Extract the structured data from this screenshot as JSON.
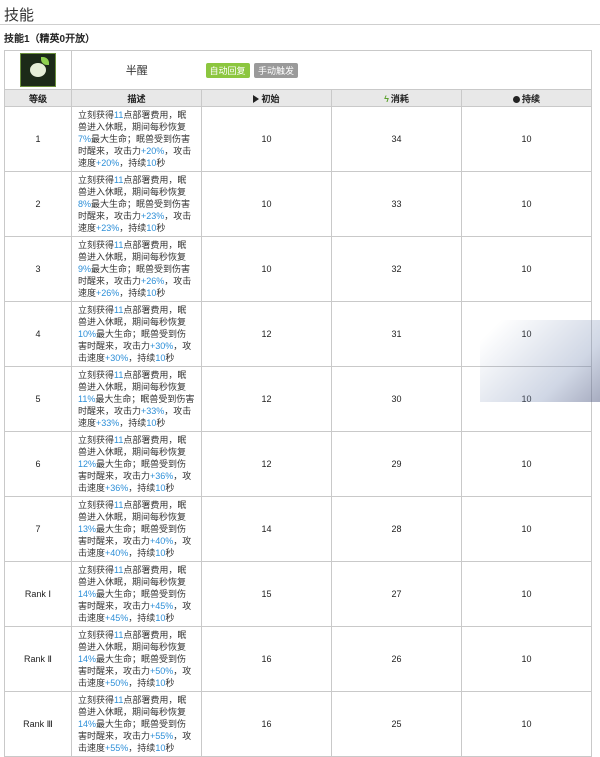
{
  "section_title": "技能",
  "skill_sub": "技能1（精英0开放）",
  "skill": {
    "name": "半醒",
    "icon": "sleeping-creature-icon",
    "tags": [
      "自动回复",
      "手动触发"
    ]
  },
  "columns": {
    "level": "等级",
    "desc": "描述",
    "initial": "初始",
    "cost": "消耗",
    "duration": "持续"
  },
  "rows": [
    {
      "level": "1",
      "p1": "立刻获得",
      "sp": "11",
      "p2": "点部署费用，眠兽进入休眠，期间每秒恢复",
      "heal": "7%",
      "p3": "最大生命；眠兽受到伤害时醒来，攻击力",
      "atk": "+20%",
      "p4": "，攻击速度",
      "aspd": "+20%",
      "p5": "，持续",
      "dur": "10",
      "p6": "秒",
      "initial": "10",
      "cost": "34",
      "duration": "10"
    },
    {
      "level": "2",
      "p1": "立刻获得",
      "sp": "11",
      "p2": "点部署费用，眠兽进入休眠，期间每秒恢复",
      "heal": "8%",
      "p3": "最大生命；眠兽受到伤害时醒来，攻击力",
      "atk": "+23%",
      "p4": "，攻击速度",
      "aspd": "+23%",
      "p5": "，持续",
      "dur": "10",
      "p6": "秒",
      "initial": "10",
      "cost": "33",
      "duration": "10"
    },
    {
      "level": "3",
      "p1": "立刻获得",
      "sp": "11",
      "p2": "点部署费用，眠兽进入休眠，期间每秒恢复",
      "heal": "9%",
      "p3": "最大生命；眠兽受到伤害时醒来，攻击力",
      "atk": "+26%",
      "p4": "，攻击速度",
      "aspd": "+26%",
      "p5": "，持续",
      "dur": "10",
      "p6": "秒",
      "initial": "10",
      "cost": "32",
      "duration": "10"
    },
    {
      "level": "4",
      "p1": "立刻获得",
      "sp": "11",
      "p2": "点部署费用，眠兽进入休眠，期间每秒恢复",
      "heal": "10%",
      "p3": "最大生命；眠兽受到伤害时醒来，攻击力",
      "atk": "+30%",
      "p4": "，攻击速度",
      "aspd": "+30%",
      "p5": "，持续",
      "dur": "10",
      "p6": "秒",
      "initial": "12",
      "cost": "31",
      "duration": "10"
    },
    {
      "level": "5",
      "p1": "立刻获得",
      "sp": "11",
      "p2": "点部署费用，眠兽进入休眠，期间每秒恢复",
      "heal": "11%",
      "p3": "最大生命；眠兽受到伤害时醒来，攻击力",
      "atk": "+33%",
      "p4": "，攻击速度",
      "aspd": "+33%",
      "p5": "，持续",
      "dur": "10",
      "p6": "秒",
      "initial": "12",
      "cost": "30",
      "duration": "10"
    },
    {
      "level": "6",
      "p1": "立刻获得",
      "sp": "11",
      "p2": "点部署费用，眠兽进入休眠，期间每秒恢复",
      "heal": "12%",
      "p3": "最大生命；眠兽受到伤害时醒来，攻击力",
      "atk": "+36%",
      "p4": "，攻击速度",
      "aspd": "+36%",
      "p5": "，持续",
      "dur": "10",
      "p6": "秒",
      "initial": "12",
      "cost": "29",
      "duration": "10"
    },
    {
      "level": "7",
      "p1": "立刻获得",
      "sp": "11",
      "p2": "点部署费用，眠兽进入休眠，期间每秒恢复",
      "heal": "13%",
      "p3": "最大生命；眠兽受到伤害时醒来，攻击力",
      "atk": "+40%",
      "p4": "，攻击速度",
      "aspd": "+40%",
      "p5": "，持续",
      "dur": "10",
      "p6": "秒",
      "initial": "14",
      "cost": "28",
      "duration": "10"
    },
    {
      "level": "Rank Ⅰ",
      "p1": "立刻获得",
      "sp": "11",
      "p2": "点部署费用，眠兽进入休眠，期间每秒恢复",
      "heal": "14%",
      "p3": "最大生命；眠兽受到伤害时醒来，攻击力",
      "atk": "+45%",
      "p4": "，攻击速度",
      "aspd": "+45%",
      "p5": "，持续",
      "dur": "10",
      "p6": "秒",
      "initial": "15",
      "cost": "27",
      "duration": "10"
    },
    {
      "level": "Rank Ⅱ",
      "p1": "立刻获得",
      "sp": "11",
      "p2": "点部署费用，眠兽进入休眠，期间每秒恢复",
      "heal": "14%",
      "p3": "最大生命；眠兽受到伤害时醒来，攻击力",
      "atk": "+50%",
      "p4": "，攻击速度",
      "aspd": "+50%",
      "p5": "，持续",
      "dur": "10",
      "p6": "秒",
      "initial": "16",
      "cost": "26",
      "duration": "10"
    },
    {
      "level": "Rank Ⅲ",
      "p1": "立刻获得",
      "sp": "11",
      "p2": "点部署费用，眠兽进入休眠，期间每秒恢复",
      "heal": "14%",
      "p3": "最大生命；眠兽受到伤害时醒来，攻击力",
      "atk": "+55%",
      "p4": "，攻击速度",
      "aspd": "+55%",
      "p5": "，持续",
      "dur": "10",
      "p6": "秒",
      "initial": "16",
      "cost": "25",
      "duration": "10"
    }
  ],
  "colors": {
    "highlight": "#2d8fd8",
    "tag_auto": "#8cc63f",
    "tag_manual": "#9a9a9a",
    "header_bg": "#e8e8e8"
  }
}
